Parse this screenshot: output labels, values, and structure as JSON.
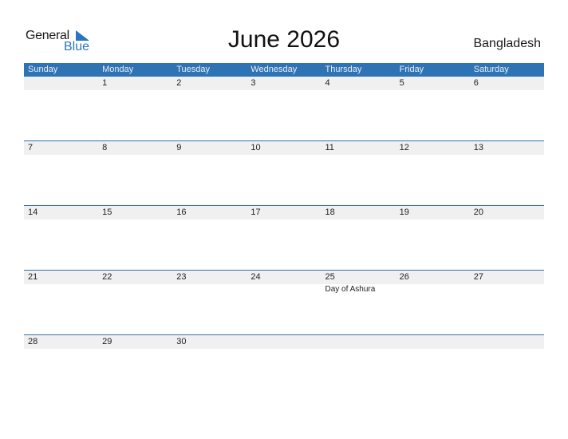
{
  "logo": {
    "word1": "General",
    "word2": "Blue"
  },
  "title": "June 2026",
  "country": "Bangladesh",
  "colors": {
    "header_bg": "#2e73b4",
    "date_band": "#f0f0f0",
    "logo_blue": "#2a75c0"
  },
  "weekdays": [
    "Sunday",
    "Monday",
    "Tuesday",
    "Wednesday",
    "Thursday",
    "Friday",
    "Saturday"
  ],
  "weeks": [
    {
      "days": [
        "",
        "1",
        "2",
        "3",
        "4",
        "5",
        "6"
      ],
      "events": [
        "",
        "",
        "",
        "",
        "",
        "",
        ""
      ]
    },
    {
      "days": [
        "7",
        "8",
        "9",
        "10",
        "11",
        "12",
        "13"
      ],
      "events": [
        "",
        "",
        "",
        "",
        "",
        "",
        ""
      ]
    },
    {
      "days": [
        "14",
        "15",
        "16",
        "17",
        "18",
        "19",
        "20"
      ],
      "events": [
        "",
        "",
        "",
        "",
        "",
        "",
        ""
      ]
    },
    {
      "days": [
        "21",
        "22",
        "23",
        "24",
        "25",
        "26",
        "27"
      ],
      "events": [
        "",
        "",
        "",
        "",
        "Day of Ashura",
        "",
        ""
      ]
    },
    {
      "days": [
        "28",
        "29",
        "30",
        "",
        "",
        "",
        ""
      ],
      "events": [
        "",
        "",
        "",
        "",
        "",
        "",
        ""
      ]
    }
  ]
}
